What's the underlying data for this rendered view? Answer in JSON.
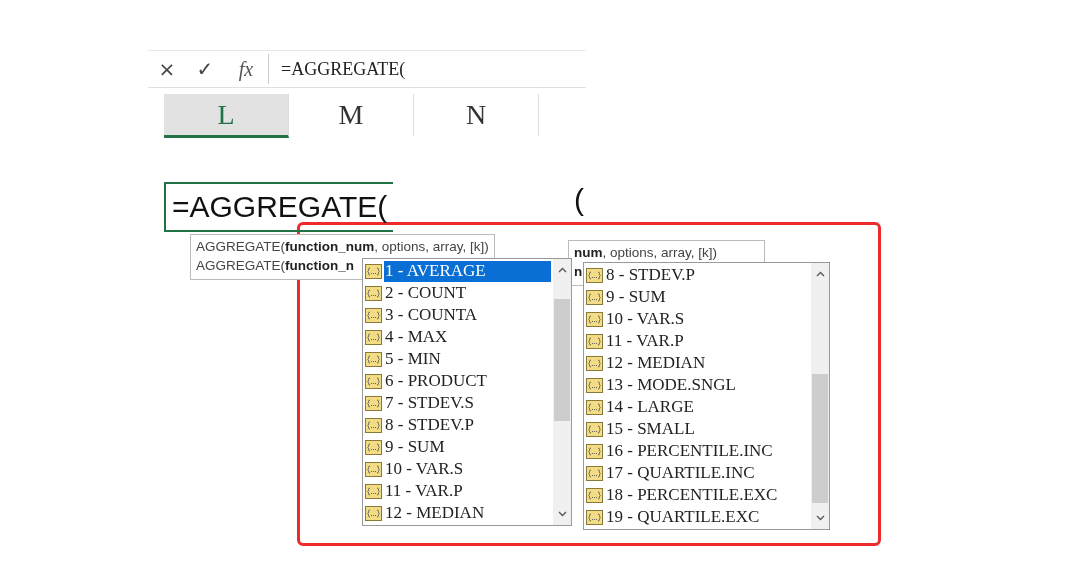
{
  "formula_bar": {
    "cancel": "×",
    "enter": "✓",
    "fx": "fx",
    "value": "=AGGREGATE("
  },
  "columns": [
    {
      "label": "L",
      "selected": true
    },
    {
      "label": "M",
      "selected": false
    },
    {
      "label": "N",
      "selected": false
    }
  ],
  "cell": {
    "value": "=AGGREGATE(",
    "second_paren": "("
  },
  "tooltip_left": {
    "lines": [
      "AGGREGATE(**function_num**, options, array, [k])",
      "AGGREGATE(**function_n**"
    ]
  },
  "tooltip_right": {
    "lines": [
      "**num**, options, array, [k])",
      "**n**"
    ]
  },
  "list_left": {
    "items": [
      {
        "label": "1 - AVERAGE",
        "selected": true
      },
      {
        "label": "2 - COUNT",
        "selected": false
      },
      {
        "label": "3 - COUNTA",
        "selected": false
      },
      {
        "label": "4 - MAX",
        "selected": false
      },
      {
        "label": "5 - MIN",
        "selected": false
      },
      {
        "label": "6 - PRODUCT",
        "selected": false
      },
      {
        "label": "7 - STDEV.S",
        "selected": false
      },
      {
        "label": "8 - STDEV.P",
        "selected": false
      },
      {
        "label": "9 - SUM",
        "selected": false
      },
      {
        "label": "10 - VAR.S",
        "selected": false
      },
      {
        "label": "11 - VAR.P",
        "selected": false
      },
      {
        "label": "12 - MEDIAN",
        "selected": false
      }
    ]
  },
  "list_right": {
    "items": [
      {
        "label": "8 - STDEV.P",
        "selected": false
      },
      {
        "label": "9 - SUM",
        "selected": false
      },
      {
        "label": "10 - VAR.S",
        "selected": false
      },
      {
        "label": "11 - VAR.P",
        "selected": false
      },
      {
        "label": "12 - MEDIAN",
        "selected": false
      },
      {
        "label": "13 - MODE.SNGL",
        "selected": false
      },
      {
        "label": "14 - LARGE",
        "selected": false
      },
      {
        "label": "15 - SMALL",
        "selected": false
      },
      {
        "label": "16 - PERCENTILE.INC",
        "selected": false
      },
      {
        "label": "17 - QUARTILE.INC",
        "selected": false
      },
      {
        "label": "18 - PERCENTILE.EXC",
        "selected": false
      },
      {
        "label": "19 - QUARTILE.EXC",
        "selected": false
      }
    ]
  }
}
